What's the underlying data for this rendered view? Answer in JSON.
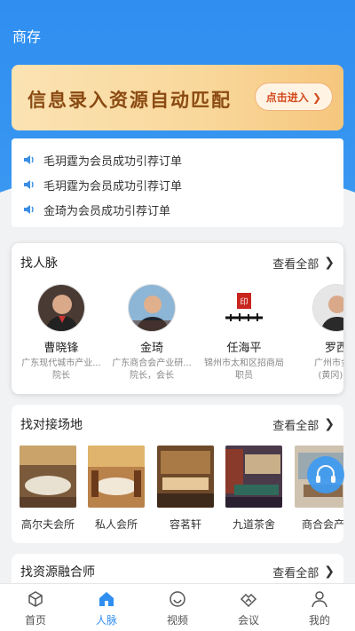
{
  "header": {
    "title": "商存"
  },
  "banner": {
    "text": "信息录入资源自动匹配",
    "button_label": "点击进入"
  },
  "notices": [
    "毛玥霆为会员成功引荐订单",
    "毛玥霆为会员成功引荐订单",
    "金琦为会员成功引荐订单"
  ],
  "people_section": {
    "title": "找人脉",
    "see_all": "查看全部",
    "people": [
      {
        "name": "曹晓锋",
        "desc1": "广东现代城市产业...",
        "desc2": "院长"
      },
      {
        "name": "金琦",
        "desc1": "广东商合会产业研...",
        "desc2": "院长，会长"
      },
      {
        "name": "任海平",
        "desc1": "锦州市太和区招商局",
        "desc2": "职员"
      },
      {
        "name": "罗西",
        "desc1": "广州市金钅",
        "desc2": "(黄冈) 料"
      }
    ]
  },
  "venue_section": {
    "title": "找对接场地",
    "see_all": "查看全部",
    "venues": [
      "高尔夫会所",
      "私人会所",
      "容茗轩",
      "九道茶舍",
      "商合会产"
    ]
  },
  "resource_section": {
    "title": "找资源融合师",
    "see_all": "查看全部"
  },
  "tabs": [
    {
      "label": "首页",
      "icon": "cube-icon"
    },
    {
      "label": "人脉",
      "icon": "home-icon"
    },
    {
      "label": "视频",
      "icon": "smile-icon"
    },
    {
      "label": "会议",
      "icon": "handshake-icon"
    },
    {
      "label": "我的",
      "icon": "user-icon"
    }
  ],
  "colors": {
    "primary": "#2f8ef0",
    "banner_text": "#8a4a12",
    "banner_button_text": "#d24a1c"
  }
}
